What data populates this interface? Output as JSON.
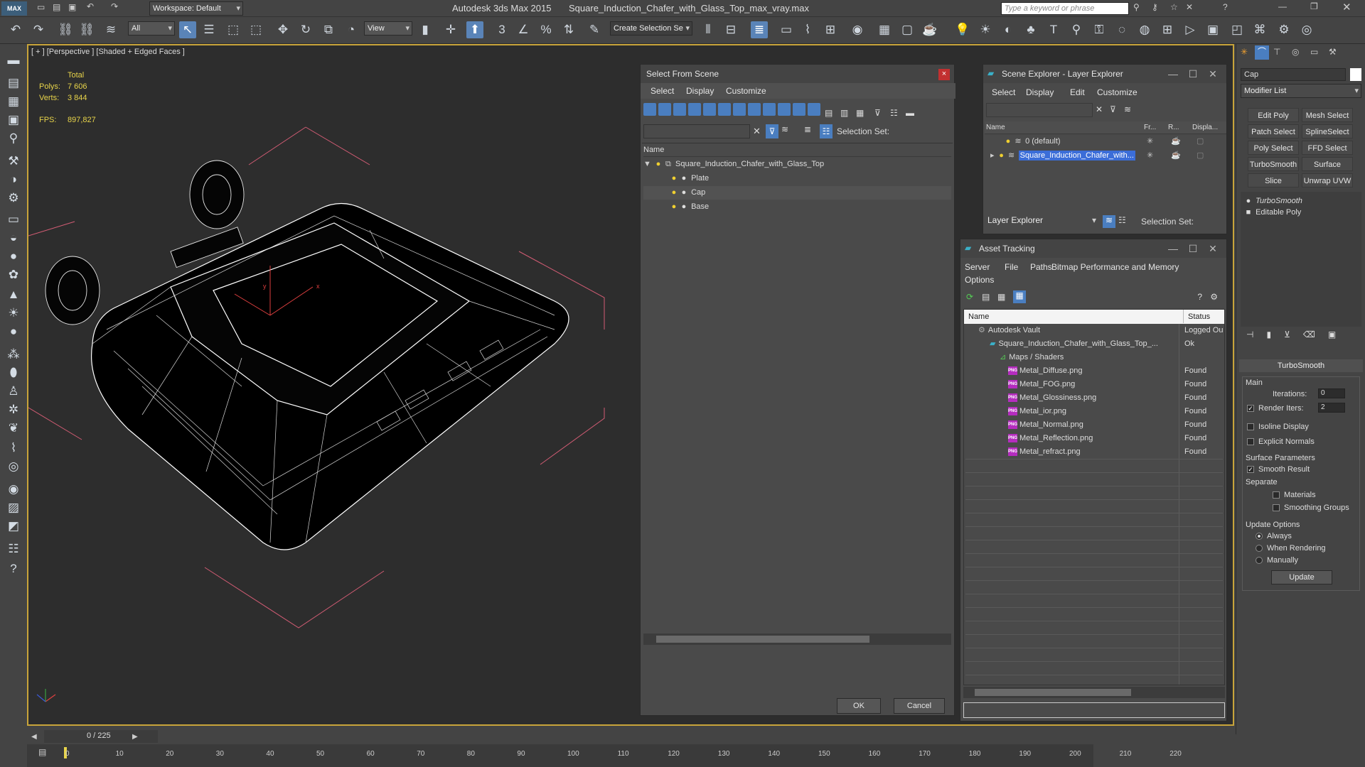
{
  "app": {
    "logo": "MAX",
    "title": "Autodesk 3ds Max  2015",
    "file": "Square_Induction_Chafer_with_Glass_Top_max_vray.max",
    "workspace": "Workspace: Default",
    "search_placeholder": "Type a keyword or phrase"
  },
  "toolbar": {
    "filter": "All",
    "coord": "View",
    "selection_set_placeholder": "Create Selection Se",
    "snap_label": "3",
    "snap_percent": "%"
  },
  "viewport": {
    "label": "[ + ] [Perspective ] [Shaded + Edged Faces ]",
    "total_label": "Total",
    "polys_label": "Polys:",
    "polys": "7 606",
    "verts_label": "Verts:",
    "verts": "3 844",
    "fps_label": "FPS:",
    "fps": "897,827",
    "axis_x": "x",
    "axis_y": "y"
  },
  "select_from_scene": {
    "title": "Select From Scene",
    "menu": [
      "Select",
      "Display",
      "Customize"
    ],
    "selection_set_label": "Selection Set:",
    "col_name": "Name",
    "root": "Square_Induction_Chafer_with_Glass_Top",
    "children": [
      "Plate",
      "Cap",
      "Base"
    ],
    "ok": "OK",
    "cancel": "Cancel"
  },
  "scene_explorer": {
    "title": "Scene Explorer - Layer Explorer",
    "menu": [
      "Select",
      "Display",
      "Edit",
      "Customize"
    ],
    "cols": [
      "Name",
      "Fr...",
      "R...",
      "Displa..."
    ],
    "rows": [
      "0 (default)",
      "Square_Induction_Chafer_with..."
    ],
    "footer_combo": "Layer Explorer",
    "selection_set_label": "Selection Set:"
  },
  "asset_tracking": {
    "title": "Asset Tracking",
    "menu": [
      "Server",
      "File",
      "Paths",
      "Bitmap Performance and Memory",
      "Options"
    ],
    "col_name": "Name",
    "col_status": "Status",
    "rows": [
      {
        "name": "Autodesk Vault",
        "status": "Logged Ou"
      },
      {
        "name": "Square_Induction_Chafer_with_Glass_Top_...",
        "status": "Ok"
      },
      {
        "name": "Maps / Shaders",
        "status": ""
      },
      {
        "name": "Metal_Diffuse.png",
        "status": "Found"
      },
      {
        "name": "Metal_FOG.png",
        "status": "Found"
      },
      {
        "name": "Metal_Glossiness.png",
        "status": "Found"
      },
      {
        "name": "Metal_ior.png",
        "status": "Found"
      },
      {
        "name": "Metal_Normal.png",
        "status": "Found"
      },
      {
        "name": "Metal_Reflection.png",
        "status": "Found"
      },
      {
        "name": "Metal_refract.png",
        "status": "Found"
      }
    ],
    "png_badge": "PNG"
  },
  "command_panel": {
    "object_name": "Cap",
    "modifier_list": "Modifier List",
    "buttons": [
      "Edit Poly",
      "Mesh Select",
      "Patch Select",
      "SplineSelect",
      "Poly Select",
      "FFD Select",
      "TurboSmooth",
      "Surface Select",
      "Slice",
      "Unwrap UVW"
    ],
    "stack": [
      "TurboSmooth",
      "Editable Poly"
    ],
    "rollout_title": "TurboSmooth",
    "main_label": "Main",
    "iterations_label": "Iterations:",
    "iterations": "0",
    "render_iters_label": "Render Iters:",
    "render_iters": "2",
    "isoline": "Isoline Display",
    "explicit_normals": "Explicit Normals",
    "surface_params": "Surface Parameters",
    "smooth_result": "Smooth Result",
    "separate": "Separate",
    "materials": "Materials",
    "smoothing_groups": "Smoothing Groups",
    "update_options": "Update Options",
    "always": "Always",
    "when_rendering": "When Rendering",
    "manually": "Manually",
    "update_btn": "Update"
  },
  "timeline": {
    "frame": "0 / 225",
    "ticks": [
      "0",
      "10",
      "20",
      "30",
      "40",
      "50",
      "60",
      "70",
      "80",
      "90",
      "100",
      "110",
      "120",
      "130",
      "140",
      "150",
      "160",
      "170",
      "180",
      "190",
      "200",
      "210",
      "220"
    ]
  },
  "colors": {
    "accent": "#5a84b8",
    "viewport_border": "#c8a43a",
    "stats": "#e8d44a",
    "highlight": "#3b6dd8"
  }
}
